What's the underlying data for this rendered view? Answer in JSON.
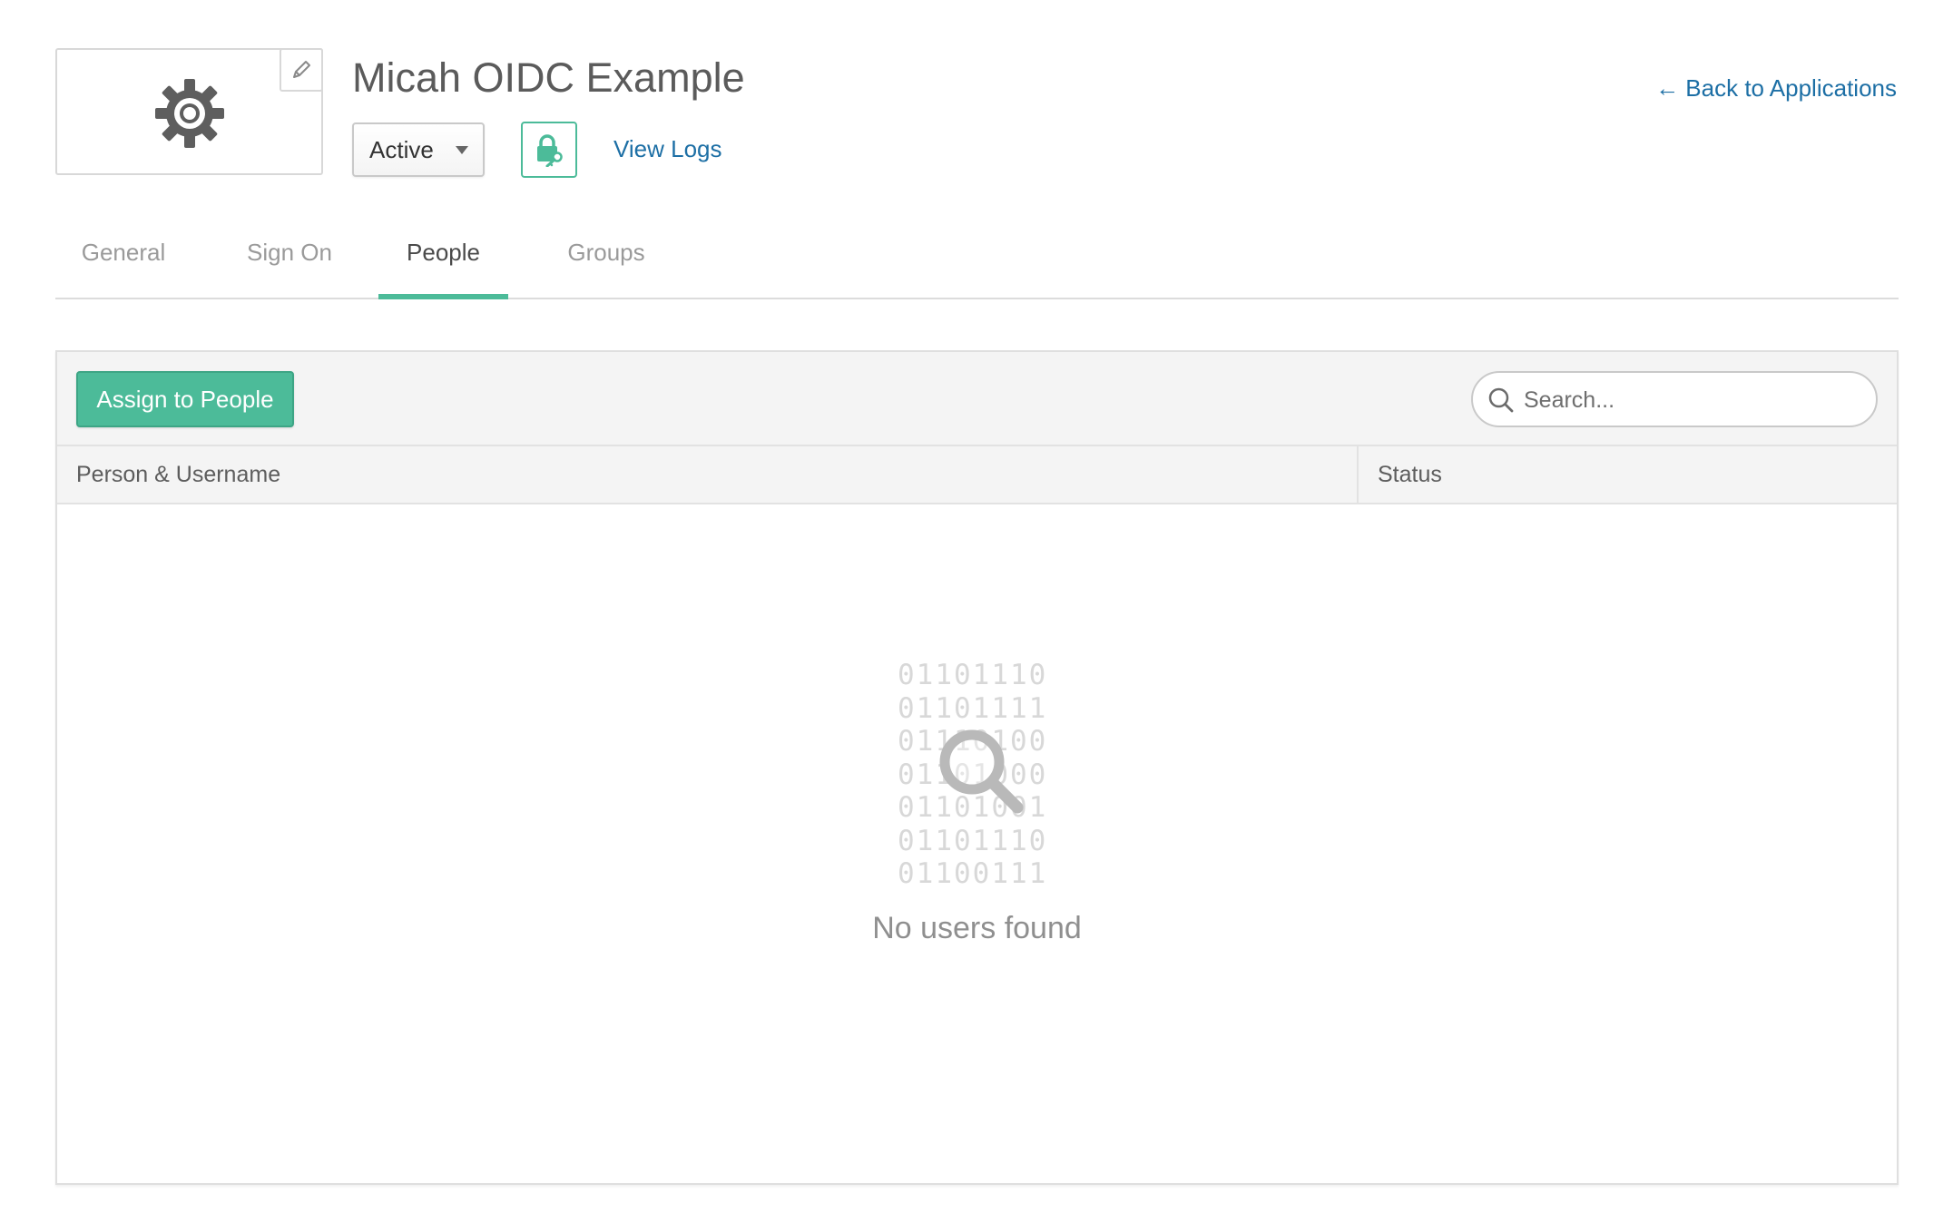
{
  "app": {
    "title": "Micah OIDC Example",
    "status_value": "Active",
    "view_logs_label": "View Logs",
    "back_link_label": "← Back to Applications",
    "logo_icon": "gear-icon",
    "edit_icon": "pencil-icon",
    "push_icon": "lock-key-icon"
  },
  "tabs": [
    {
      "label": "General",
      "active": false
    },
    {
      "label": "Sign On",
      "active": false
    },
    {
      "label": "People",
      "active": true
    },
    {
      "label": "Groups",
      "active": false
    }
  ],
  "toolbar": {
    "assign_label": "Assign to People",
    "search_placeholder": "Search...",
    "search_icon": "search-icon"
  },
  "table": {
    "columns": [
      "Person & Username",
      "Status"
    ],
    "rows": []
  },
  "empty_state": {
    "binary_lines": [
      "01101110",
      "01101111",
      "01110100",
      "01101000",
      "01101001",
      "01101110",
      "01100111"
    ],
    "message": "No users found",
    "icon": "magnifier-icon"
  },
  "colors": {
    "accent": "#4cbb99",
    "link": "#1d6fa5",
    "text": "#5d5d5d",
    "muted": "#9a9a9a",
    "panel_header_bg": "#f4f4f4"
  }
}
